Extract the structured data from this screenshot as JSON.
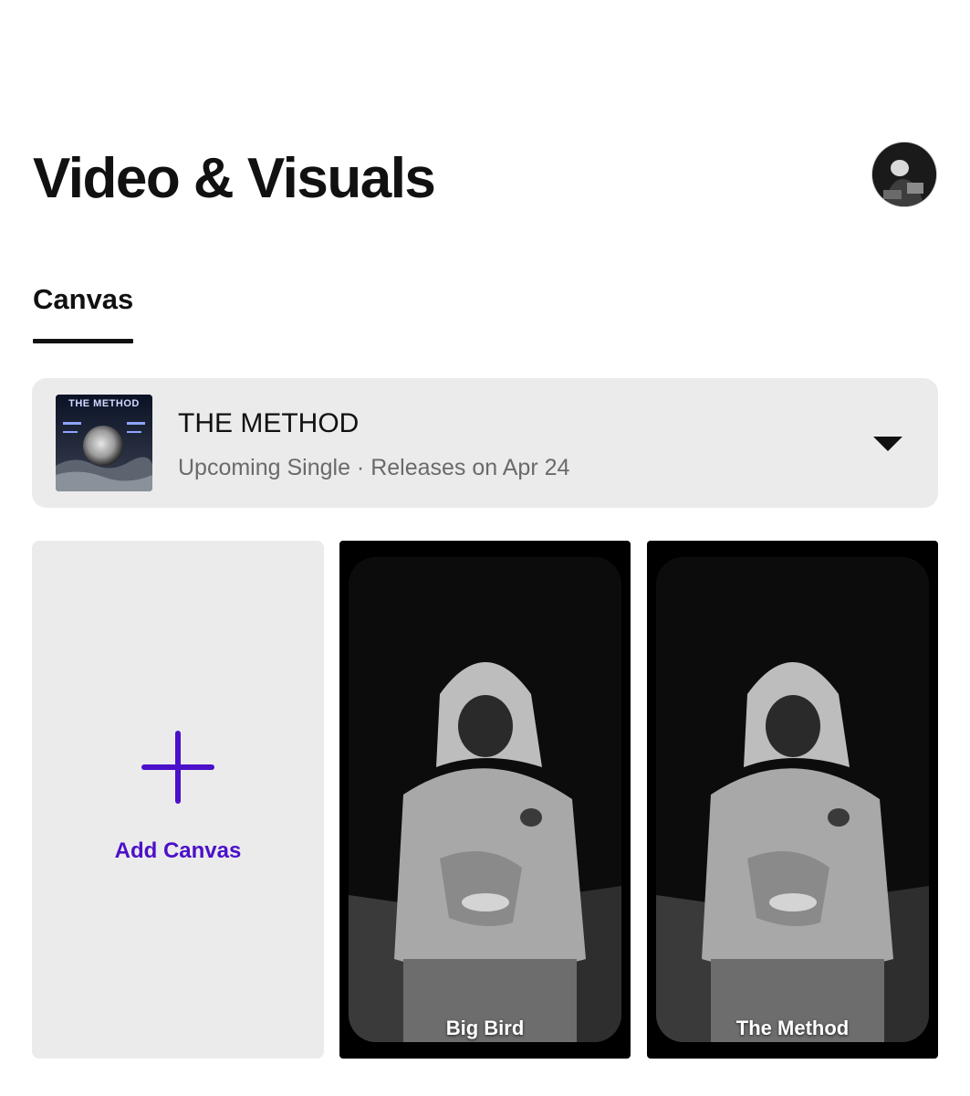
{
  "header": {
    "title": "Video & Visuals"
  },
  "tabs": [
    {
      "label": "Canvas",
      "active": true
    }
  ],
  "release": {
    "cover_text": "THE METHOD",
    "name": "THE METHOD",
    "meta": "Upcoming Single · Releases on Apr 24"
  },
  "add_canvas": {
    "label": "Add Canvas",
    "accent_color": "#4b10c9"
  },
  "canvases": [
    {
      "label": "Big Bird"
    },
    {
      "label": "The Method"
    }
  ],
  "icons": {
    "avatar": "avatar",
    "dropdown": "chevron-down-icon",
    "add": "plus-icon"
  }
}
